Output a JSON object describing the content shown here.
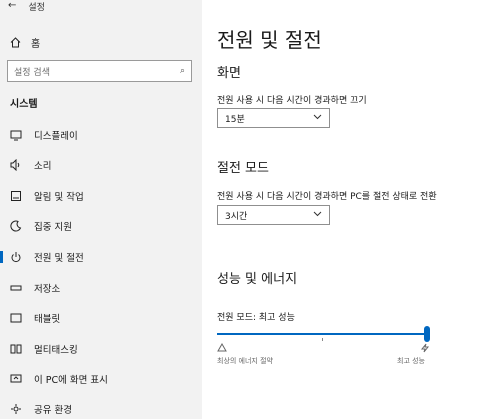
{
  "window": {
    "back_glyph": "←",
    "title": "설정"
  },
  "sidebar": {
    "home_label": "홈",
    "search_placeholder": "설정 검색",
    "section_label": "시스템",
    "items": [
      {
        "label": "디스플레이",
        "icon": "monitor-icon"
      },
      {
        "label": "소리",
        "icon": "speaker-icon"
      },
      {
        "label": "알림 및 작업",
        "icon": "notification-icon"
      },
      {
        "label": "집중 지원",
        "icon": "moon-icon"
      },
      {
        "label": "전원 및 절전",
        "icon": "power-icon",
        "active": true
      },
      {
        "label": "저장소",
        "icon": "storage-icon"
      },
      {
        "label": "태블릿",
        "icon": "tablet-icon"
      },
      {
        "label": "멀티태스킹",
        "icon": "multitasking-icon"
      },
      {
        "label": "이 PC에 화면 표시",
        "icon": "project-icon"
      },
      {
        "label": "공유 환경",
        "icon": "share-icon"
      }
    ]
  },
  "main": {
    "title": "전원 및 절전",
    "screen": {
      "heading": "화면",
      "label": "전원 사용 시 다음 시간이 경과하면 끄기",
      "value": "15분"
    },
    "sleep": {
      "heading": "절전 모드",
      "label": "전원 사용 시 다음 시간이 경과하면 PC를 절전 상태로 전환",
      "value": "3시간"
    },
    "performance": {
      "heading": "성능 및 에너지",
      "power_mode_label": "전원 모드: 최고 성능",
      "slider_value": 1.0,
      "left_label": "최상의 에너지 절약",
      "right_label": "최고 성능"
    }
  },
  "colors": {
    "accent": "#0067c0",
    "sidebar_bg": "#f2f2f2"
  }
}
